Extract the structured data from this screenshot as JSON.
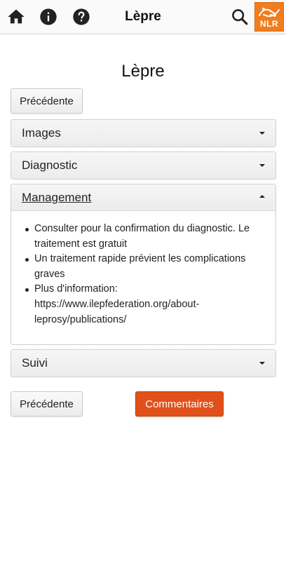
{
  "header": {
    "title": "Lèpre",
    "home_icon": "home-icon",
    "info_icon": "info-icon",
    "help_icon": "help-icon",
    "search_icon": "search-icon",
    "logo_text": "NLR"
  },
  "page": {
    "title": "Lèpre"
  },
  "nav": {
    "previous_label": "Précédente",
    "comments_label": "Commentaires"
  },
  "accordion": [
    {
      "label": "Images",
      "expanded": false
    },
    {
      "label": "Diagnostic",
      "expanded": false
    },
    {
      "label": "Management",
      "expanded": true,
      "items": [
        "Consulter pour la confirmation du diagnostic. Le traitement est gratuit",
        "Un traitement rapide prévient les complications graves",
        "Plus d'information: https://www.ilepfederation.org/about-leprosy/publications/"
      ]
    },
    {
      "label": "Suivi",
      "expanded": false
    }
  ],
  "colors": {
    "accent": "#e1501a",
    "logo": "#f07d1e"
  }
}
